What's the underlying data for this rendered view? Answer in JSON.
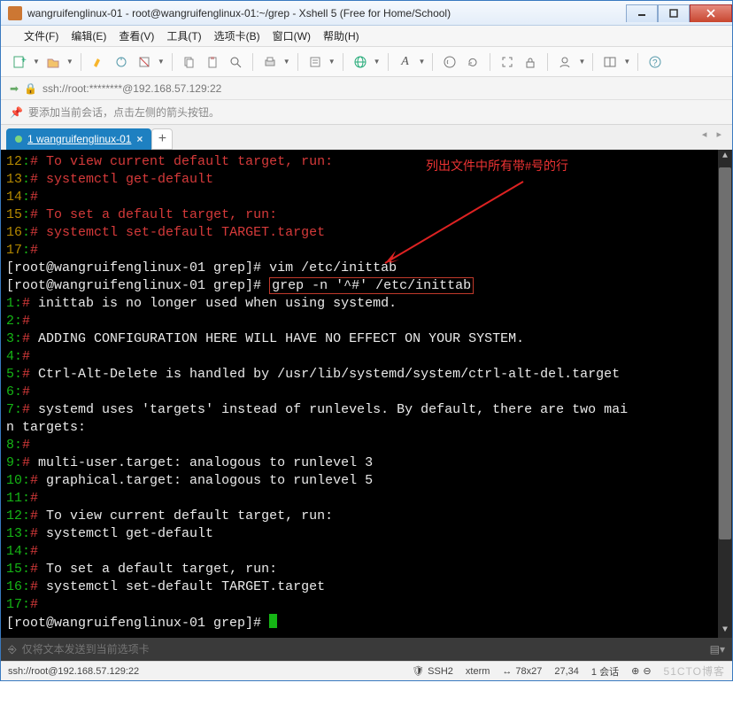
{
  "title": "wangruifenglinux-01 - root@wangruifenglinux-01:~/grep - Xshell 5 (Free for Home/School)",
  "menus": [
    "文件(F)",
    "编辑(E)",
    "查看(V)",
    "工具(T)",
    "选项卡(B)",
    "窗口(W)",
    "帮助(H)"
  ],
  "toolbar_icons": [
    "new",
    "open",
    "|",
    "paint",
    "link",
    "copy",
    "|",
    "cut",
    "copy2",
    "paste",
    "search",
    "|",
    "print",
    "|",
    "props",
    "|",
    "globe",
    "|",
    "font",
    "|",
    "reload",
    "sync",
    "|",
    "fullscreen",
    "lock",
    "|",
    "user",
    "|",
    "layout",
    "|",
    "help"
  ],
  "address_value": "ssh://root:********@192.168.57.129:22",
  "hint_text": "要添加当前会话，点击左侧的箭头按钮。",
  "tab_label": "1 wangruifenglinux-01",
  "annotation_text": "列出文件中所有带#号的行",
  "terminal": {
    "block1": [
      {
        "ln": "12",
        "txt": "# To view current default target, run:"
      },
      {
        "ln": "13",
        "txt": "# systemctl get-default"
      },
      {
        "ln": "14",
        "txt": "#"
      },
      {
        "ln": "15",
        "txt": "# To set a default target, run:"
      },
      {
        "ln": "16",
        "txt": "# systemctl set-default TARGET.target"
      },
      {
        "ln": "17",
        "txt": "#"
      }
    ],
    "prompt1_pre": "[root@wangruifenglinux-01 grep]# ",
    "prompt1_cmd": "vim /etc/inittab",
    "prompt2_pre": "[root@wangruifenglinux-01 grep]# ",
    "prompt2_cmd": "grep -n '^#' /etc/inittab",
    "block2": [
      {
        "ln": "1",
        "h": "#",
        "txt": " inittab is no longer used when using systemd."
      },
      {
        "ln": "2",
        "h": "#",
        "txt": ""
      },
      {
        "ln": "3",
        "h": "#",
        "txt": " ADDING CONFIGURATION HERE WILL HAVE NO EFFECT ON YOUR SYSTEM."
      },
      {
        "ln": "4",
        "h": "#",
        "txt": ""
      },
      {
        "ln": "5",
        "h": "#",
        "txt": " Ctrl-Alt-Delete is handled by /usr/lib/systemd/system/ctrl-alt-del.target"
      },
      {
        "ln": "6",
        "h": "#",
        "txt": ""
      }
    ],
    "wrap_a": {
      "ln": "7",
      "h": "#",
      "txt": " systemd uses 'targets' instead of runlevels. By default, there are two mai"
    },
    "wrap_b": "n targets:",
    "block3": [
      {
        "ln": "8",
        "h": "#",
        "txt": ""
      },
      {
        "ln": "9",
        "h": "#",
        "txt": " multi-user.target: analogous to runlevel 3"
      },
      {
        "ln": "10",
        "h": "#",
        "txt": " graphical.target: analogous to runlevel 5"
      },
      {
        "ln": "11",
        "h": "#",
        "txt": ""
      },
      {
        "ln": "12",
        "h": "#",
        "txt": " To view current default target, run:"
      },
      {
        "ln": "13",
        "h": "#",
        "txt": " systemctl get-default"
      },
      {
        "ln": "14",
        "h": "#",
        "txt": ""
      },
      {
        "ln": "15",
        "h": "#",
        "txt": " To set a default target, run:"
      },
      {
        "ln": "16",
        "h": "#",
        "txt": " systemctl set-default TARGET.target"
      },
      {
        "ln": "17",
        "h": "#",
        "txt": ""
      }
    ],
    "prompt3": "[root@wangruifenglinux-01 grep]# "
  },
  "send_placeholder": "仅将文本发送到当前选项卡",
  "status": {
    "conn": "ssh://root@192.168.57.129:22",
    "ssh": "SSH2",
    "term": "xterm",
    "size": "78x27",
    "pos": "27,34",
    "sess": "1 会话"
  },
  "watermark": "51CTO博客"
}
